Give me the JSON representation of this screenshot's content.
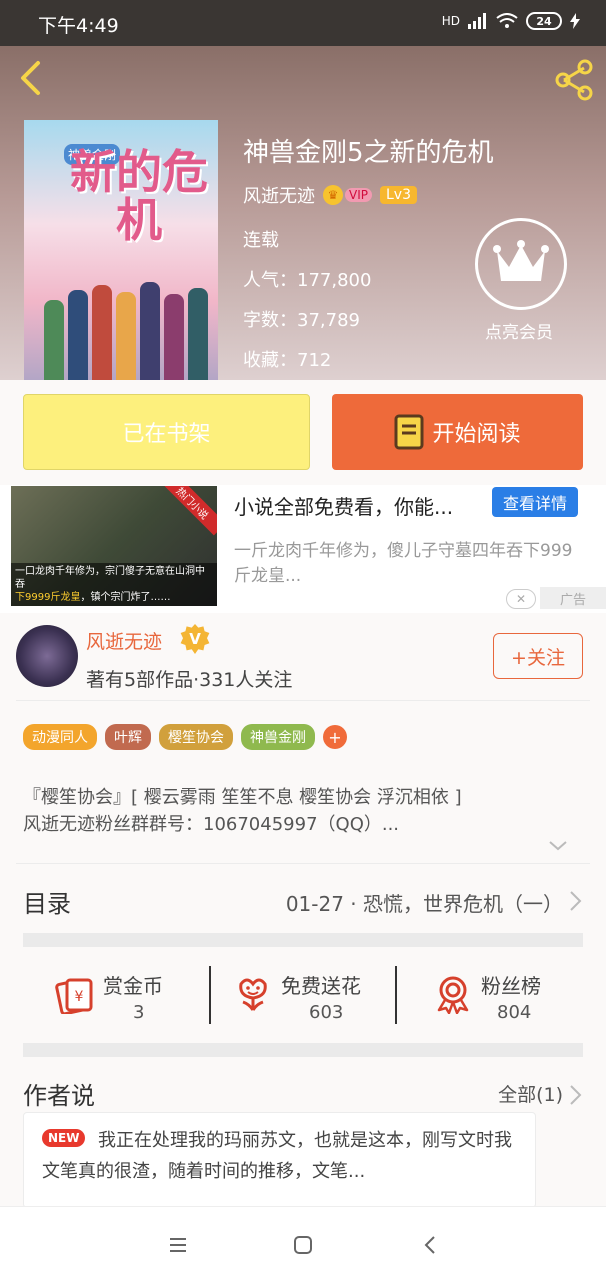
{
  "status": {
    "time": "下午4:49",
    "network": "HD",
    "battery": "24"
  },
  "book": {
    "title": "神兽金刚5之新的危机",
    "author": "风逝无迹",
    "vip_label": "VIP",
    "level": "Lv3",
    "status": "连载",
    "popularity": "人气：177,800",
    "word_count": "字数：37,789",
    "favorites": "收藏：712",
    "cover_title": "新的危机",
    "cover_series": "神兽金刚"
  },
  "member": {
    "label": "点亮会员"
  },
  "actions": {
    "shelf_label": "已在书架",
    "read_label": "开始阅读"
  },
  "ad": {
    "title": "小说全部免费看，你能...",
    "detail_label": "查看详情",
    "description": "一斤龙肉千年修为，傻儿子守墓四年吞下999斤龙皇...",
    "hot_label": "热门小说",
    "caption_line1": "一口龙肉千年修为，宗门傻子无意在山洞中吞",
    "caption_highlight": "下9999斤龙皇",
    "caption_line2": "，镇个宗门炸了……",
    "tag": "广告"
  },
  "author_card": {
    "name": "风逝无迹",
    "badge": "V",
    "stats": "著有5部作品·331人关注",
    "follow_label": "+关注"
  },
  "tags": [
    {
      "label": "动漫同人",
      "color": "#f3a52c"
    },
    {
      "label": "叶辉",
      "color": "#c16a4f"
    },
    {
      "label": "樱笙协会",
      "color": "#d1a03c"
    },
    {
      "label": "神兽金刚",
      "color": "#8fb94e"
    }
  ],
  "intro": {
    "line1": "『樱笙协会』[ 樱云雾雨 笙笙不息 樱笙协会 浮沉相依 ]",
    "line2": "风逝无迹粉丝群群号：1067045997（QQ）..."
  },
  "toc": {
    "label": "目录",
    "latest": "01-27 · 恐慌，世界危机（一）"
  },
  "stats": [
    {
      "name": "赏金币",
      "value": "3"
    },
    {
      "name": "免费送花",
      "value": "603"
    },
    {
      "name": "粉丝榜",
      "value": "804"
    }
  ],
  "author_says": {
    "title": "作者说",
    "all_label": "全部(1)",
    "new_label": "NEW",
    "text": "我正在处理我的玛丽苏文，也就是这本，刚写文时我文笔真的很渣，随着时间的推移，文笔..."
  },
  "colors": {
    "accent": "#ee6a3a",
    "shelf_button": "#fdf07d",
    "ad_button": "#2a7ee6",
    "status_bar": "#3a3633"
  }
}
